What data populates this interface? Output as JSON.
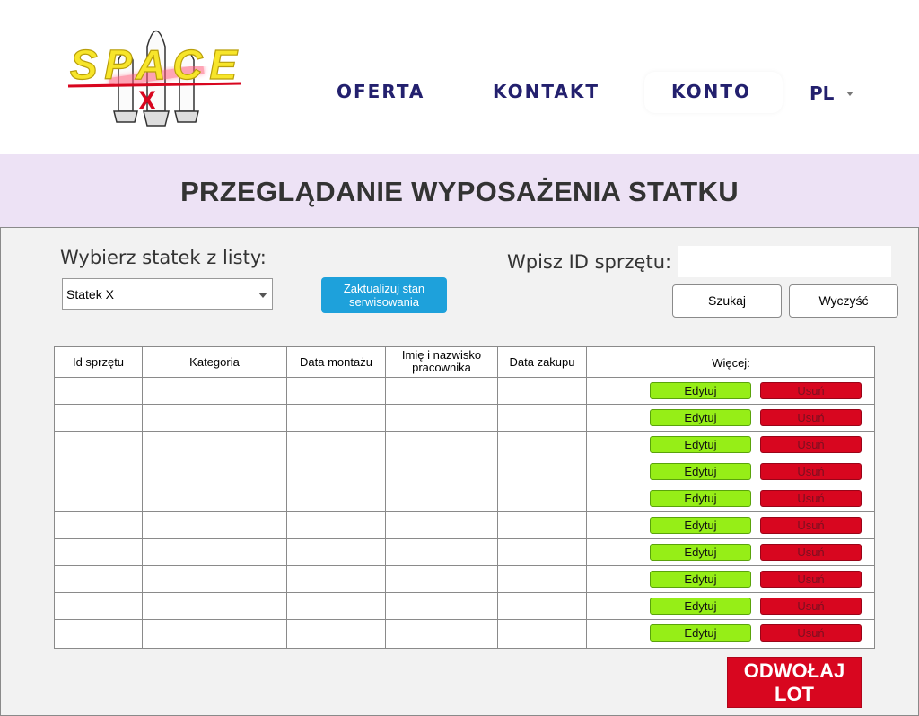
{
  "header": {
    "logo_text": "SPACE",
    "logo_letter": "X",
    "nav": [
      {
        "label": "OFERTA"
      },
      {
        "label": "KONTAKT"
      },
      {
        "label": "KONTO"
      }
    ],
    "language": "PL"
  },
  "page_title": "PRZEGLĄDANIE WYPOSAŻENIA STATKU",
  "controls": {
    "select_label": "Wybierz statek z listy:",
    "select_value": "Statek X",
    "update_button": "Zaktualizuj stan serwisowania",
    "id_label": "Wpisz ID sprzętu:",
    "id_value": "",
    "search_button": "Szukaj",
    "clear_button": "Wyczyść"
  },
  "table": {
    "headers": [
      "Id sprzętu",
      "Kategoria",
      "Data montażu",
      "Imię i nazwisko pracownika",
      "Data zakupu",
      "Więcej:"
    ],
    "edit_label": "Edytuj",
    "delete_label": "Usuń",
    "rows": [
      [
        "",
        "",
        "",
        "",
        ""
      ],
      [
        "",
        "",
        "",
        "",
        ""
      ],
      [
        "",
        "",
        "",
        "",
        ""
      ],
      [
        "",
        "",
        "",
        "",
        ""
      ],
      [
        "",
        "",
        "",
        "",
        ""
      ],
      [
        "",
        "",
        "",
        "",
        ""
      ],
      [
        "",
        "",
        "",
        "",
        ""
      ],
      [
        "",
        "",
        "",
        "",
        ""
      ],
      [
        "",
        "",
        "",
        "",
        ""
      ],
      [
        "",
        "",
        "",
        "",
        ""
      ]
    ]
  },
  "cancel_button": "ODWOŁAJ LOT",
  "colors": {
    "nav": "#23206e",
    "title_band": "#ede2f5",
    "panel": "#f2f2f2",
    "update_button": "#1ea1db",
    "edit_button": "#96ee17",
    "delete_button": "#d8061f",
    "cancel_button": "#d8061f"
  }
}
